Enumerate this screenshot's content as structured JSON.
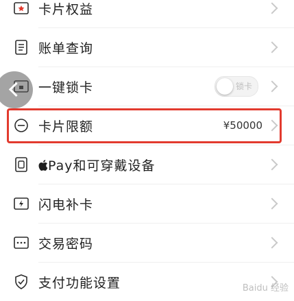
{
  "menu": {
    "card_benefits": {
      "label": "卡片权益"
    },
    "bill_query": {
      "label": "账单查询"
    },
    "one_key_lock": {
      "label": "一键锁卡",
      "toggle_label": "锁卡"
    },
    "card_limit": {
      "label": "卡片限额",
      "value": "¥50000"
    },
    "apple_pay": {
      "label": "Pay和可穿戴设备"
    },
    "flash_card": {
      "label": "闪电补卡"
    },
    "trade_password": {
      "label": "交易密码"
    },
    "payment_settings": {
      "label": "支付功能设置"
    }
  },
  "icons": {
    "card_benefits": "card-star-icon",
    "bill_query": "bill-document-icon",
    "one_key_lock": "card-lock-icon",
    "card_limit": "limit-circle-icon",
    "apple_pay": "wearable-device-icon",
    "flash_card": "flash-card-icon",
    "trade_password": "password-keypad-icon",
    "payment_settings": "shield-settings-icon"
  },
  "colors": {
    "highlight": "#e23a2e",
    "chevron": "#c9c9c9"
  },
  "watermark": {
    "text": "Baidu 经验"
  }
}
